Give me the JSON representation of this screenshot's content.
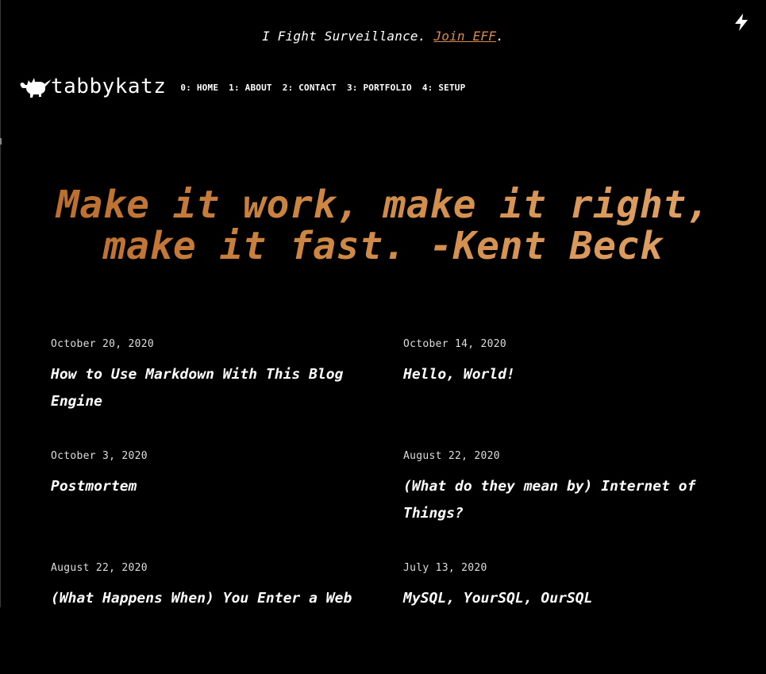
{
  "banner": {
    "text": "I Fight Surveillance. ",
    "link": "Join EFF",
    "suffix": "."
  },
  "icons": {
    "top_right": "lightning-bolt-icon",
    "logo": "cat-logo-icon"
  },
  "site": {
    "name": "tabbykatz"
  },
  "nav": [
    {
      "label": "0: HOME"
    },
    {
      "label": "1: ABOUT"
    },
    {
      "label": "2: CONTACT"
    },
    {
      "label": "3: PORTFOLIO"
    },
    {
      "label": "4: SETUP"
    }
  ],
  "hero": {
    "line1": "Make it work, make it right,",
    "line2": "make it fast. -Kent Beck"
  },
  "posts": [
    {
      "date": "October 20, 2020",
      "title": "How to Use Markdown With This Blog Engine"
    },
    {
      "date": "October 14, 2020",
      "title": "Hello, World!"
    },
    {
      "date": "October 3, 2020",
      "title": "Postmortem"
    },
    {
      "date": "August 22, 2020",
      "title": "(What do they mean by) Internet of Things?"
    },
    {
      "date": "August 22, 2020",
      "title": "(What Happens When) You Enter a Web"
    },
    {
      "date": "July 13, 2020",
      "title": "MySQL, YourSQL, OurSQL"
    }
  ],
  "colors": {
    "background": "#000000",
    "accent": "#d98b4a",
    "hero_start": "#b9692a",
    "hero_end": "#e3a56b"
  }
}
